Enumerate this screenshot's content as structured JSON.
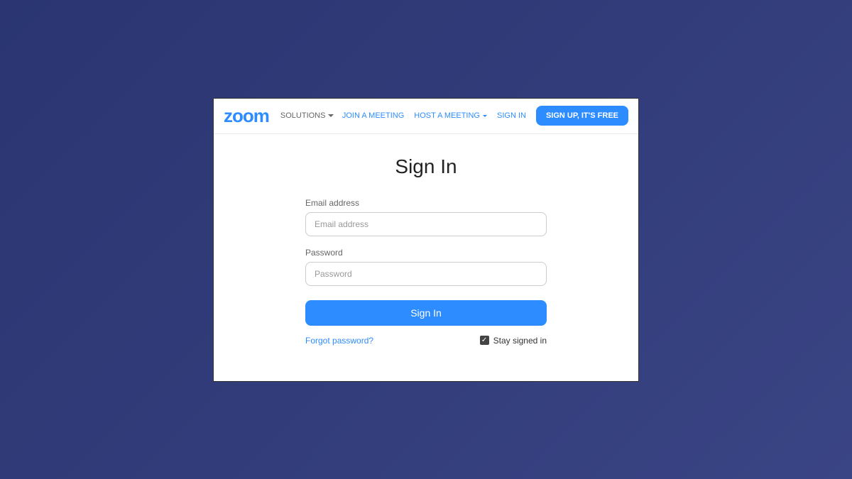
{
  "header": {
    "logo_text": "zoom",
    "solutions_label": "SOLUTIONS",
    "nav": {
      "join_meeting": "JOIN A MEETING",
      "host_meeting": "HOST A MEETING",
      "sign_in": "SIGN IN"
    },
    "signup_button": "SIGN UP, IT'S FREE"
  },
  "page": {
    "title": "Sign In",
    "email_label": "Email address",
    "email_placeholder": "Email address",
    "password_label": "Password",
    "password_placeholder": "Password",
    "submit_label": "Sign In",
    "forgot_password": "Forgot password?",
    "stay_signed_label": "Stay signed in",
    "stay_signed_checked": true
  }
}
